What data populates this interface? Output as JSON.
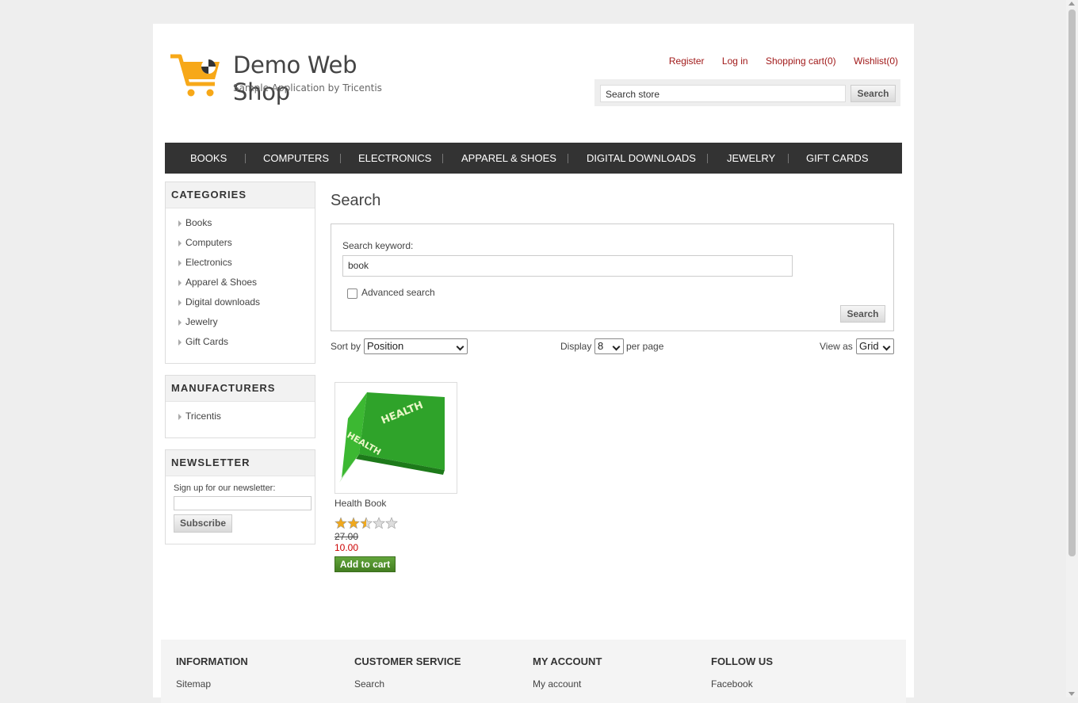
{
  "header": {
    "brand": "Demo Web Shop",
    "tagline": "Sample Application by Tricentis",
    "links": [
      "Register",
      "Log in",
      "Shopping cart(0)",
      "Wishlist(0)"
    ],
    "search_value": "Search store",
    "search_button": "Search"
  },
  "menu": [
    "BOOKS",
    "COMPUTERS",
    "ELECTRONICS",
    "APPAREL & SHOES",
    "DIGITAL DOWNLOADS",
    "JEWELRY",
    "GIFT CARDS"
  ],
  "sidebar": {
    "categories_title": "CATEGORIES",
    "categories": [
      "Books",
      "Computers",
      "Electronics",
      "Apparel & Shoes",
      "Digital downloads",
      "Jewelry",
      "Gift Cards"
    ],
    "manufacturers_title": "MANUFACTURERS",
    "manufacturers": [
      "Tricentis"
    ],
    "newsletter_title": "NEWSLETTER",
    "newsletter_label": "Sign up for our newsletter:",
    "subscribe": "Subscribe"
  },
  "main": {
    "title": "Search",
    "keyword_label": "Search keyword:",
    "keyword_value": "book",
    "advanced_label": "Advanced search",
    "search_button": "Search",
    "sort_label": "Sort by",
    "sort_value": "Position",
    "display_label": "Display",
    "display_value": "8",
    "per_page": "per page",
    "view_label": "View as",
    "view_value": "Grid"
  },
  "product": {
    "name": "Health Book",
    "book_text": "HEALTH",
    "rating": 2.5,
    "rating_max": 5,
    "old_price": "27.00",
    "price": "10.00",
    "add_to_cart": "Add to cart"
  },
  "footer": {
    "columns": [
      {
        "heading": "INFORMATION",
        "link": "Sitemap"
      },
      {
        "heading": "CUSTOMER SERVICE",
        "link": "Search"
      },
      {
        "heading": "MY ACCOUNT",
        "link": "My account"
      },
      {
        "heading": "FOLLOW US",
        "link": "Facebook"
      }
    ]
  },
  "colors": {
    "link_red": "#a11a1a",
    "menu_bg": "#333333",
    "star": "#f0a81c",
    "cart_green": "#4f8e2b",
    "book_green": "#2fa32a",
    "logo_orange": "#f7a818"
  }
}
